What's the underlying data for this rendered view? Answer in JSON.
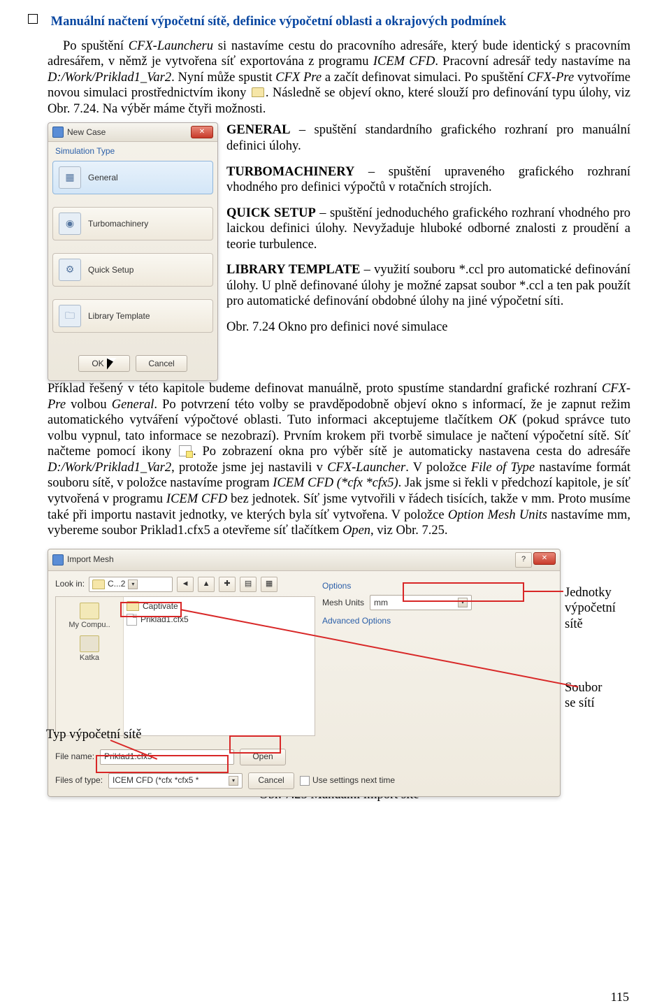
{
  "heading": "Manuální načtení výpočetní sítě, definice výpočetní oblasti a okrajových podmínek",
  "para1_a": "Po spuštění ",
  "para1_launcher": "CFX-Launcheru",
  "para1_b": " si nastavíme cestu do pracovního adresáře, který bude identický s pracovním adresářem, v němž je vytvořena síť exportována z programu ",
  "para1_icem": "ICEM CFD",
  "para1_c": ". Pracovní adresář tedy nastavíme na ",
  "para1_path": "D:/Work/Priklad1_Var2",
  "para1_d": ". Nyní může spustit ",
  "para1_cfxpre": "CFX Pre",
  "para1_e": " a začít definovat simulaci. Po spuštění ",
  "para1_cfxpre2": "CFX-Pre",
  "para1_f": " vytvoříme novou simulaci prostřednictvím ikony ",
  "para1_g": ". Následně se objeví okno, které slouží pro definování typu úlohy, viz Obr. 7.24. Na výběr máme čtyři možnosti.",
  "newcase": {
    "title": "New Case",
    "section": "Simulation Type",
    "items": [
      "General",
      "Turbomachinery",
      "Quick Setup",
      "Library Template"
    ],
    "ok": "OK",
    "cancel": "Cancel"
  },
  "desc": {
    "general_b": "GENERAL",
    "general_t": " – spuštění standardního grafického rozhraní pro manuální definici úlohy.",
    "turbo_b": "TURBOMACHINERY",
    "turbo_t": " – spuštění upraveného grafického rozhraní vhodného pro definici výpočtů v rotačních strojích.",
    "quick_b": "QUICK SETUP",
    "quick_t": " – spuštění jednoduchého grafického rozhraní vhodného pro laickou definici úlohy. Nevyžaduje hluboké odborné znalosti z proudění a teorie turbulence.",
    "lib_b": "LIBRARY TEMPLATE",
    "lib_t": " – využití souboru *.ccl pro automatické definování úlohy. U plně definované úlohy je možné zapsat soubor *.ccl a ten pak použít pro automatické definování obdobné úlohy na jiné výpočetní síti.",
    "caption": "Obr. 7.24 Okno pro definici nové simulace"
  },
  "para2_a": "Příklad řešený v této kapitole budeme definovat manuálně, proto spustíme standardní grafické rozhraní ",
  "para2_cfxpre": "CFX-Pre",
  "para2_b": " volbou ",
  "para2_general": "General",
  "para2_c": ". Po potvrzení této volby se pravděpodobně objeví okno s informací, že je zapnut režim automatického vytváření výpočtové oblasti. Tuto informaci akceptujeme tlačítkem ",
  "para2_ok": "OK",
  "para2_d": " (pokud správce tuto volbu vypnul, tato informace se nezobrazí). Prvním krokem při tvorbě simulace je načtení výpočetní sítě. Síť načteme pomocí ikony ",
  "para2_e": ". Po zobrazení okna pro výběr sítě je automaticky nastavena cesta do adresáře ",
  "para2_path": "D:/Work/Priklad1_Var2",
  "para2_f": ", protože jsme jej nastavili v ",
  "para2_launcher": "CFX-Launcher",
  "para2_g": ". V položce ",
  "para2_fot": "File of Type",
  "para2_h": " nastavíme formát souboru sítě, v položce nastavíme program ",
  "para2_icem": "ICEM CFD (*cfx *cfx5)",
  "para2_i": ". Jak jsme si řekli v předchozí kapitole, je síť vytvořená v programu ",
  "para2_icem2": "ICEM CFD",
  "para2_j": " bez jednotek. Síť jsme vytvořili v řádech tisících, takže v mm. Proto musíme také při importu nastavit jednotky, ve kterých byla síť vytvořena. V položce ",
  "para2_opt": "Option Mesh Units",
  "para2_k": " nastavíme mm, vybereme soubor Priklad1.cfx5 a otevřeme síť tlačítkem ",
  "para2_open": "Open",
  "para2_l": ", viz Obr. 7.25.",
  "import": {
    "title": "Import Mesh",
    "lookin_label": "Look in:",
    "lookin_value": "C...2",
    "side1": "My Compu..",
    "side2": "Katka",
    "file_folder": "Captivate",
    "file_doc": "Priklad1.cfx5",
    "options": "Options",
    "mesh_units": "Mesh Units",
    "mesh_units_val": "mm",
    "adv": "Advanced Options",
    "filename_label": "File name:",
    "filename_val": "Priklad1.cfx5",
    "filetype_label": "Files of type:",
    "filetype_val": "ICEM CFD (*cfx *cfx5 *",
    "open": "Open",
    "cancel": "Cancel",
    "use_next": "Use settings next time"
  },
  "anno": {
    "units": "Jednotky výpočetní sítě",
    "file": "Soubor se sítí",
    "type": "Typ výpočetní sítě"
  },
  "caption2": "Obr. 7.25 Manuální import sítě",
  "page_num": "115"
}
